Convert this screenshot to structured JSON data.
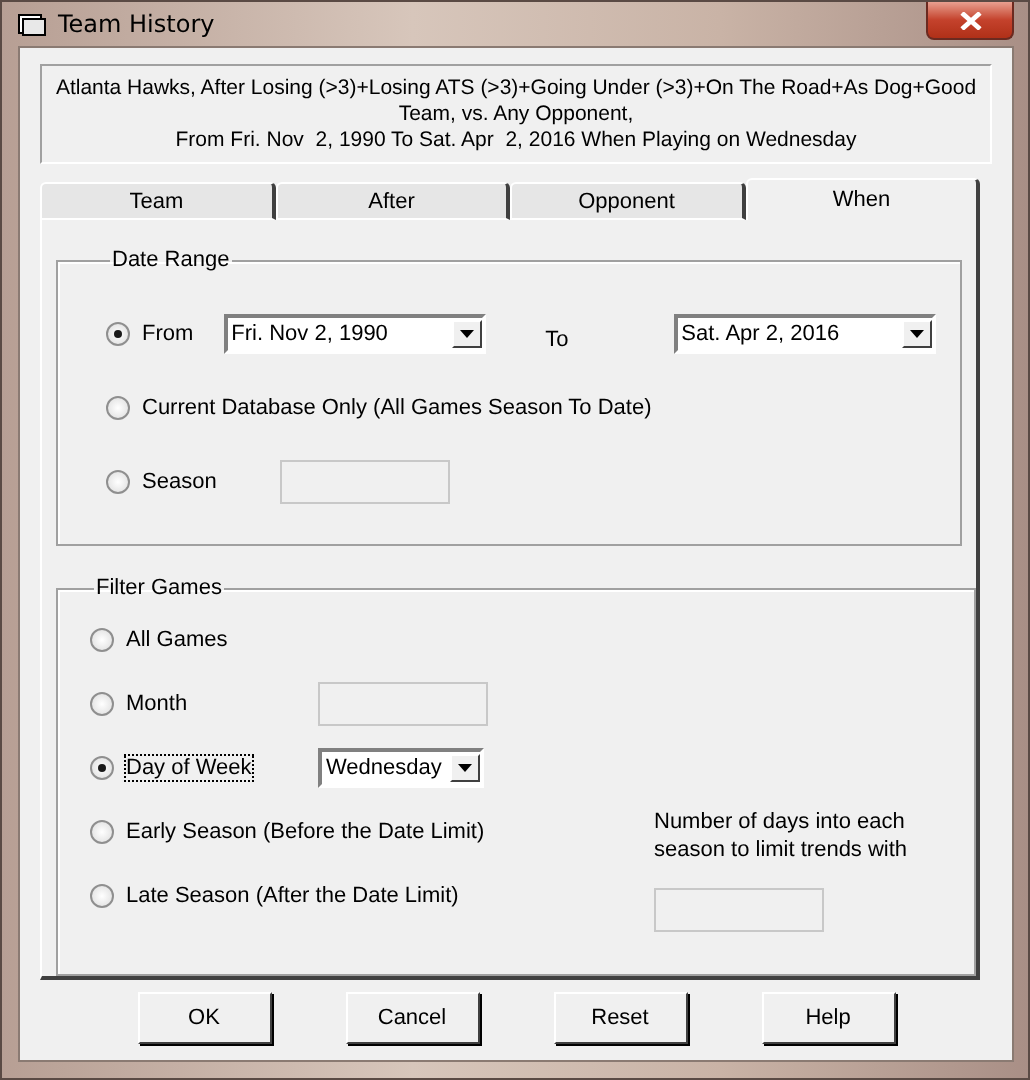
{
  "window": {
    "title": "Team History"
  },
  "summary": [
    "Atlanta Hawks, After Losing (>3)+Losing ATS (>3)+Going Under (>3)+On The Road+As Dog+Good",
    "Team, vs. Any Opponent,",
    "From Fri. Nov  2, 1990 To Sat. Apr  2, 2016 When Playing on Wednesday"
  ],
  "tabs": [
    {
      "label": "Team",
      "selected": false
    },
    {
      "label": "After",
      "selected": false
    },
    {
      "label": "Opponent",
      "selected": false
    },
    {
      "label": "When",
      "selected": true
    }
  ],
  "date_range": {
    "title": "Date Range",
    "options": [
      {
        "kind": "dates",
        "label": "From",
        "selected": true,
        "from": "Fri. Nov  2, 1990",
        "to_label": "To",
        "to": "Sat. Apr  2, 2016"
      },
      {
        "kind": "plain",
        "label": "Current Database Only (All Games Season To Date)",
        "selected": false
      },
      {
        "kind": "field",
        "label": "Season",
        "selected": false
      }
    ]
  },
  "filter_games": {
    "title": "Filter Games",
    "options": [
      {
        "kind": "plain",
        "label": "All Games",
        "selected": false,
        "focused": false
      },
      {
        "kind": "field",
        "label": "Month",
        "selected": false,
        "focused": false
      },
      {
        "kind": "combo",
        "label": "Day of Week",
        "selected": true,
        "focused": true,
        "value": "Wednesday"
      },
      {
        "kind": "plain",
        "label": "Early Season (Before the Date Limit)",
        "selected": false,
        "focused": false
      },
      {
        "kind": "plain",
        "label": "Late Season (After the Date Limit)",
        "selected": false,
        "focused": false
      }
    ],
    "days_label": "Number of days into each season to limit trends with"
  },
  "buttons": [
    "OK",
    "Cancel",
    "Reset",
    "Help"
  ]
}
